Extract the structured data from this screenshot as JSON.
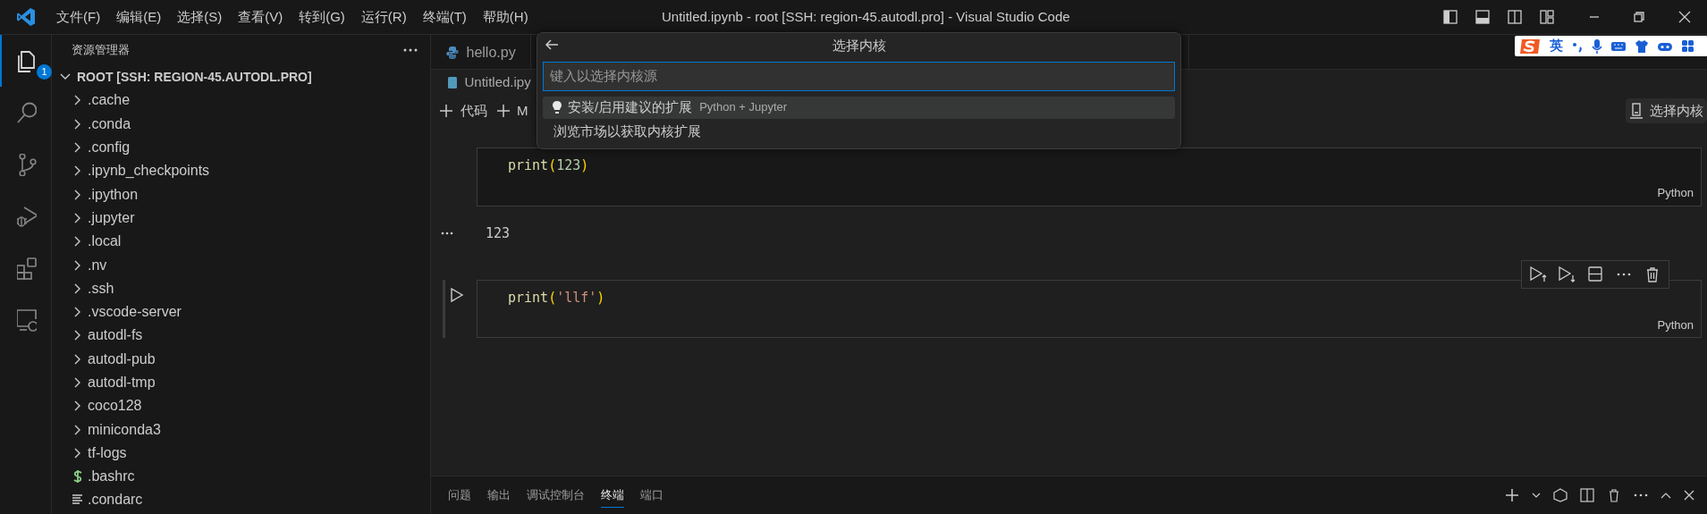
{
  "window": {
    "title": "Untitled.ipynb - root [SSH: region-45.autodl.pro] - Visual Studio Code"
  },
  "menu": [
    "文件(F)",
    "编辑(E)",
    "选择(S)",
    "查看(V)",
    "转到(G)",
    "运行(R)",
    "终端(T)",
    "帮助(H)"
  ],
  "activity_bar": [
    {
      "kind": "files",
      "selected": true,
      "badge": "1"
    },
    {
      "kind": "search",
      "selected": false
    },
    {
      "kind": "source-control",
      "selected": false
    },
    {
      "kind": "run",
      "selected": false
    },
    {
      "kind": "extensions",
      "selected": false
    },
    {
      "kind": "remote",
      "selected": false
    }
  ],
  "explorer": {
    "title": "资源管理器",
    "root": {
      "label": "ROOT [SSH: REGION-45.AUTODL.PRO]",
      "expanded": true
    },
    "items": [
      {
        "label": ".cache",
        "kind": "folder"
      },
      {
        "label": ".conda",
        "kind": "folder"
      },
      {
        "label": ".config",
        "kind": "folder"
      },
      {
        "label": ".ipynb_checkpoints",
        "kind": "folder"
      },
      {
        "label": ".ipython",
        "kind": "folder"
      },
      {
        "label": ".jupyter",
        "kind": "folder"
      },
      {
        "label": ".local",
        "kind": "folder"
      },
      {
        "label": ".nv",
        "kind": "folder"
      },
      {
        "label": ".ssh",
        "kind": "folder"
      },
      {
        "label": ".vscode-server",
        "kind": "folder"
      },
      {
        "label": "autodl-fs",
        "kind": "folder"
      },
      {
        "label": "autodl-pub",
        "kind": "folder"
      },
      {
        "label": "autodl-tmp",
        "kind": "folder"
      },
      {
        "label": "coco128",
        "kind": "folder"
      },
      {
        "label": "miniconda3",
        "kind": "folder"
      },
      {
        "label": "tf-logs",
        "kind": "folder"
      },
      {
        "label": ".bashrc",
        "kind": "shell"
      },
      {
        "label": ".condarc",
        "kind": "text"
      }
    ]
  },
  "tabs": [
    {
      "label": "hello.py"
    }
  ],
  "breadcrumb": "Untitled.ipy",
  "notebook_toolbar": [
    "代码",
    "M"
  ],
  "kernel_button": "选择内核",
  "cells": [
    {
      "selected": false,
      "language": "Python",
      "output": "123",
      "tokens": [
        {
          "text": "print",
          "kind": "function"
        },
        {
          "text": "(",
          "kind": "paren"
        },
        {
          "text": "123",
          "kind": "number"
        },
        {
          "text": ")",
          "kind": "paren"
        }
      ]
    },
    {
      "selected": true,
      "language": "Python",
      "tokens": [
        {
          "text": "print",
          "kind": "function"
        },
        {
          "text": "(",
          "kind": "paren"
        },
        {
          "text": "'llf'",
          "kind": "string"
        },
        {
          "text": ")",
          "kind": "paren"
        }
      ]
    }
  ],
  "quick_pick": {
    "title": "选择内核",
    "placeholder": "键入以选择内核源",
    "items": [
      {
        "label": "安装/启用建议的扩展",
        "detail": "Python + Jupyter",
        "selected": true
      },
      {
        "label": "浏览市场以获取内核扩展",
        "selected": false
      }
    ]
  },
  "panel_tabs": [
    {
      "label": "问题",
      "selected": false
    },
    {
      "label": "输出",
      "selected": false
    },
    {
      "label": "调试控制台",
      "selected": false
    },
    {
      "label": "终端",
      "selected": true
    },
    {
      "label": "端口",
      "selected": false
    }
  ],
  "ime": {
    "label": "英"
  }
}
